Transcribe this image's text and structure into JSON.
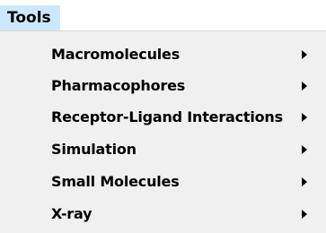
{
  "menubar": {
    "title": "Tools"
  },
  "menu": {
    "items": [
      {
        "label": "Macromolecules",
        "has_submenu": true
      },
      {
        "label": "Pharmacophores",
        "has_submenu": true
      },
      {
        "label": "Receptor-Ligand Interactions",
        "has_submenu": true
      },
      {
        "label": "Simulation",
        "has_submenu": true
      },
      {
        "label": "Small Molecules",
        "has_submenu": true
      },
      {
        "label": "X-ray",
        "has_submenu": true
      }
    ]
  },
  "colors": {
    "menubar_highlight": "#cce8ff",
    "menu_background": "#f0f0f0"
  },
  "icons": {
    "submenu": "submenu-arrow-icon"
  }
}
